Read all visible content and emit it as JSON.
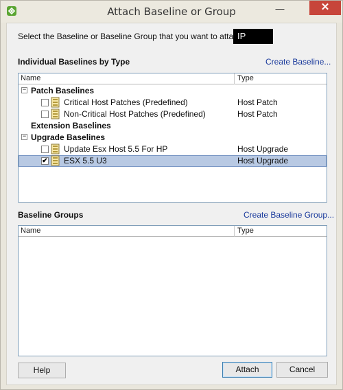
{
  "window": {
    "title": "Attach Baseline or Group"
  },
  "instruction": "Select the Baseline or Baseline Group that you want to attach to",
  "target": "IP",
  "individual": {
    "title": "Individual Baselines by Type",
    "create_link": "Create Baseline...",
    "columns": {
      "name": "Name",
      "type": "Type"
    },
    "groups": [
      {
        "label": "Patch Baselines",
        "expanded": true,
        "items": [
          {
            "label": "Critical Host Patches (Predefined)",
            "type": "Host Patch",
            "checked": false
          },
          {
            "label": "Non-Critical Host Patches (Predefined)",
            "type": "Host Patch",
            "checked": false
          }
        ]
      },
      {
        "label": "Extension Baselines",
        "expanded": false,
        "items": []
      },
      {
        "label": "Upgrade Baselines",
        "expanded": true,
        "items": [
          {
            "label": "Update Esx Host 5.5 For HP",
            "type": "Host Upgrade",
            "checked": false
          },
          {
            "label": "ESX 5.5 U3",
            "type": "Host Upgrade",
            "checked": true,
            "selected": true
          }
        ]
      }
    ]
  },
  "groups_section": {
    "title": "Baseline Groups",
    "create_link": "Create Baseline Group...",
    "columns": {
      "name": "Name",
      "type": "Type"
    }
  },
  "buttons": {
    "help": "Help",
    "attach": "Attach",
    "cancel": "Cancel"
  },
  "glyphs": {
    "minimize": "—",
    "close": "✕",
    "check": "✔",
    "expanded": "−"
  },
  "colors": {
    "close": "#c7453a",
    "selection": "#b8c9e3",
    "link": "#1a3a9c"
  }
}
